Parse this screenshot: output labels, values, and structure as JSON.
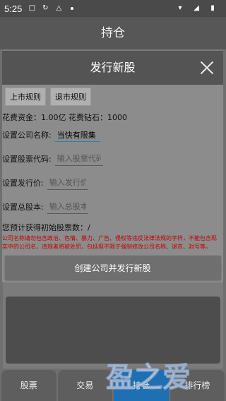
{
  "status_bar": {
    "time": "5:25"
  },
  "app": {
    "title": "持仓"
  },
  "dialog": {
    "title": "发行新股",
    "rules": [
      "上市规则",
      "退市规则"
    ],
    "cost": "花费资金：1.00亿 花费钻石：1000",
    "fields": {
      "company_name": {
        "label": "设置公司名称:",
        "value": "当快有限集"
      },
      "stock_code": {
        "label": "设置股票代码:",
        "placeholder": "输入股票代码"
      },
      "issue_price": {
        "label": "设置发行价:",
        "placeholder": "输入发行价"
      },
      "total_shares": {
        "label": "设置总股本:",
        "placeholder": "输入总股本"
      }
    },
    "estimate": "您预计获得初始股票数：/",
    "warning": "公司名称请勿包含政治、色情、暴力、广告、侵权等违反法律法规的字样，不能包含现实中的公司名，违规者将被处罚，包括但不限于强制修改公司名称、退市、封号等。",
    "create_button": "创建公司并发行新股"
  },
  "bottom_nav": [
    "股票",
    "交易",
    "持仓",
    "排行榜"
  ],
  "colors": {
    "active_tab": "#1f6fb3",
    "warning": "#c40000"
  },
  "watermark": {
    "text": "盈之爱"
  }
}
